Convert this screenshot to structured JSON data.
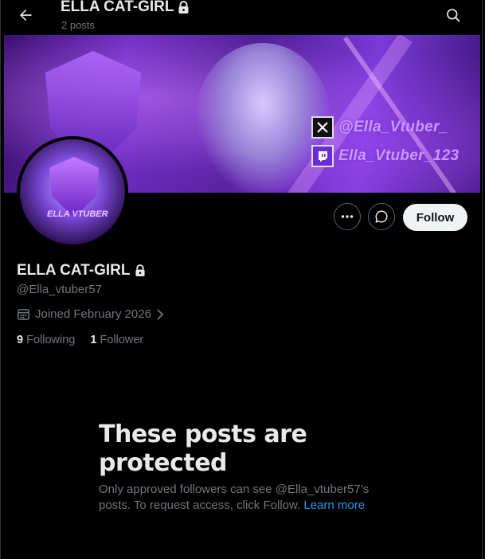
{
  "header": {
    "title": "ELLA CAT-GIRL",
    "posts_count": "2 posts"
  },
  "banner": {
    "x_handle": "@Ella_Vtuber_",
    "twitch_handle": "Ella_Vtuber_123",
    "avatar_text": "ELLA VTUBER"
  },
  "profile": {
    "name": "ELLA CAT-GIRL",
    "handle": "@Ella_vtuber57",
    "joined": "Joined February 2026",
    "following_count": "9",
    "following_label": "Following",
    "followers_count": "1",
    "followers_label": "Follower"
  },
  "actions": {
    "follow_label": "Follow"
  },
  "protected": {
    "title": "These posts are protected",
    "body": "Only approved followers can see @Ella_vtuber57’s posts. To request access, click Follow.",
    "learn_more": "Learn more"
  },
  "colors": {
    "background": "#000000",
    "text_primary": "#e7e9ea",
    "text_secondary": "#71767b",
    "link": "#1d9bf0",
    "follow_bg": "#eff3f4",
    "accent_purple": "#7a3ad6"
  },
  "icons": {
    "back": "arrow-left-icon",
    "search": "search-icon",
    "lock": "lock-icon",
    "more": "more-icon",
    "message": "message-icon",
    "calendar": "calendar-icon",
    "chevron": "chevron-right-icon",
    "x_logo": "x-logo-icon",
    "twitch_logo": "twitch-logo-icon"
  }
}
